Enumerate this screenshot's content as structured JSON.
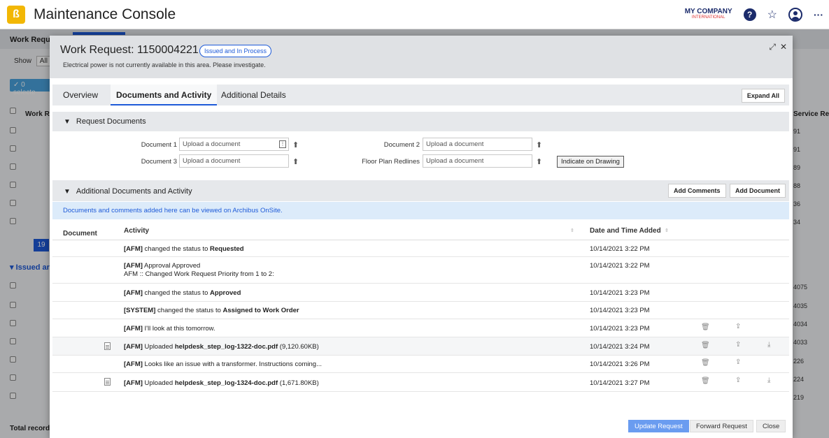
{
  "app": {
    "logo_glyph": "ß",
    "title": "Maintenance Console",
    "company_line1": "MY COMPANY",
    "company_line2": "INTERNATIONAL",
    "help_glyph": "?",
    "favorites_glyph": "☆",
    "more_glyph": "···"
  },
  "background": {
    "section_title": "Work Reque",
    "show_label": "Show",
    "show_value": "All",
    "selected_label": "✓ 0 selecte",
    "col_work_request": "Work Re",
    "col_service_request": "Service Req",
    "page_number": "19",
    "issued_section": "▾ Issued ar",
    "total_records": "Total record",
    "right_numbers_top": [
      "91",
      "91",
      "89",
      "88",
      "36",
      "34"
    ],
    "right_numbers_bottom": [
      "4075",
      "4035",
      "4034",
      "4033",
      "226",
      "224",
      "219"
    ]
  },
  "modal": {
    "title": "Work Request: 1150004221",
    "status_badge": "Issued and In Process",
    "description": "Electrical power is not currently available in this area. Please investigate.",
    "expand_glyph": "⤢",
    "close_glyph": "✕",
    "tabs": [
      {
        "label": "Overview"
      },
      {
        "label": "Documents and Activity"
      },
      {
        "label": "Additional Details"
      }
    ],
    "expand_all_label": "Expand All",
    "request_documents": {
      "title": "Request Documents",
      "fields": [
        {
          "label": "Document 1",
          "placeholder": "Upload a document"
        },
        {
          "label": "Document 2",
          "placeholder": "Upload a document"
        },
        {
          "label": "Document 3",
          "placeholder": "Upload a document"
        },
        {
          "label": "Floor Plan Redlines",
          "placeholder": "Upload a document"
        }
      ],
      "indicate_button": "Indicate on Drawing"
    },
    "additional": {
      "title": "Additional Documents and Activity",
      "add_comments": "Add Comments",
      "add_document": "Add Document",
      "info_text": "Documents and comments added here can be viewed on Archibus OnSite.",
      "col_document": "Document",
      "col_activity": "Activity",
      "col_date": "Date and Time Added",
      "rows": [
        {
          "who": "[AFM]",
          "text": " changed the status to ",
          "bold": "Requested",
          "text2": "",
          "extra": "",
          "date": "10/14/2021 3:22 PM"
        },
        {
          "who": "[AFM]",
          "text": " Approval Approved",
          "bold": "",
          "text2": "",
          "extra": "AFM :: Changed Work Request Priority from 1 to 2:",
          "date": "10/14/2021 3:22 PM"
        },
        {
          "who": "[AFM]",
          "text": " changed the status to ",
          "bold": "Approved",
          "text2": "",
          "extra": "",
          "date": "10/14/2021 3:23 PM"
        },
        {
          "who": "[SYSTEM]",
          "text": " changed the status to ",
          "bold": "Assigned to Work Order",
          "text2": "",
          "extra": "",
          "date": "10/14/2021 3:23 PM"
        },
        {
          "who": "[AFM]",
          "text": " I'll look at this tomorrow.",
          "bold": "",
          "text2": "",
          "extra": "",
          "date": "10/14/2021 3:23 PM"
        },
        {
          "who": "[AFM]",
          "text": " Uploaded ",
          "bold": "helpdesk_step_log-1322-doc.pdf",
          "text2": " (9,120.60KB)",
          "extra": "",
          "date": "10/14/2021 3:24 PM"
        },
        {
          "who": "[AFM]",
          "text": " Looks like an issue with a transformer. Instructions coming...",
          "bold": "",
          "text2": "",
          "extra": "",
          "date": "10/14/2021 3:26 PM"
        },
        {
          "who": "[AFM]",
          "text": " Uploaded ",
          "bold": "helpdesk_step_log-1324-doc.pdf",
          "text2": " (1,671.80KB)",
          "extra": "",
          "date": "10/14/2021 3:27 PM"
        }
      ]
    },
    "footer": {
      "update_request": "Update Request",
      "forward_request": "Forward Request",
      "close": "Close"
    }
  }
}
